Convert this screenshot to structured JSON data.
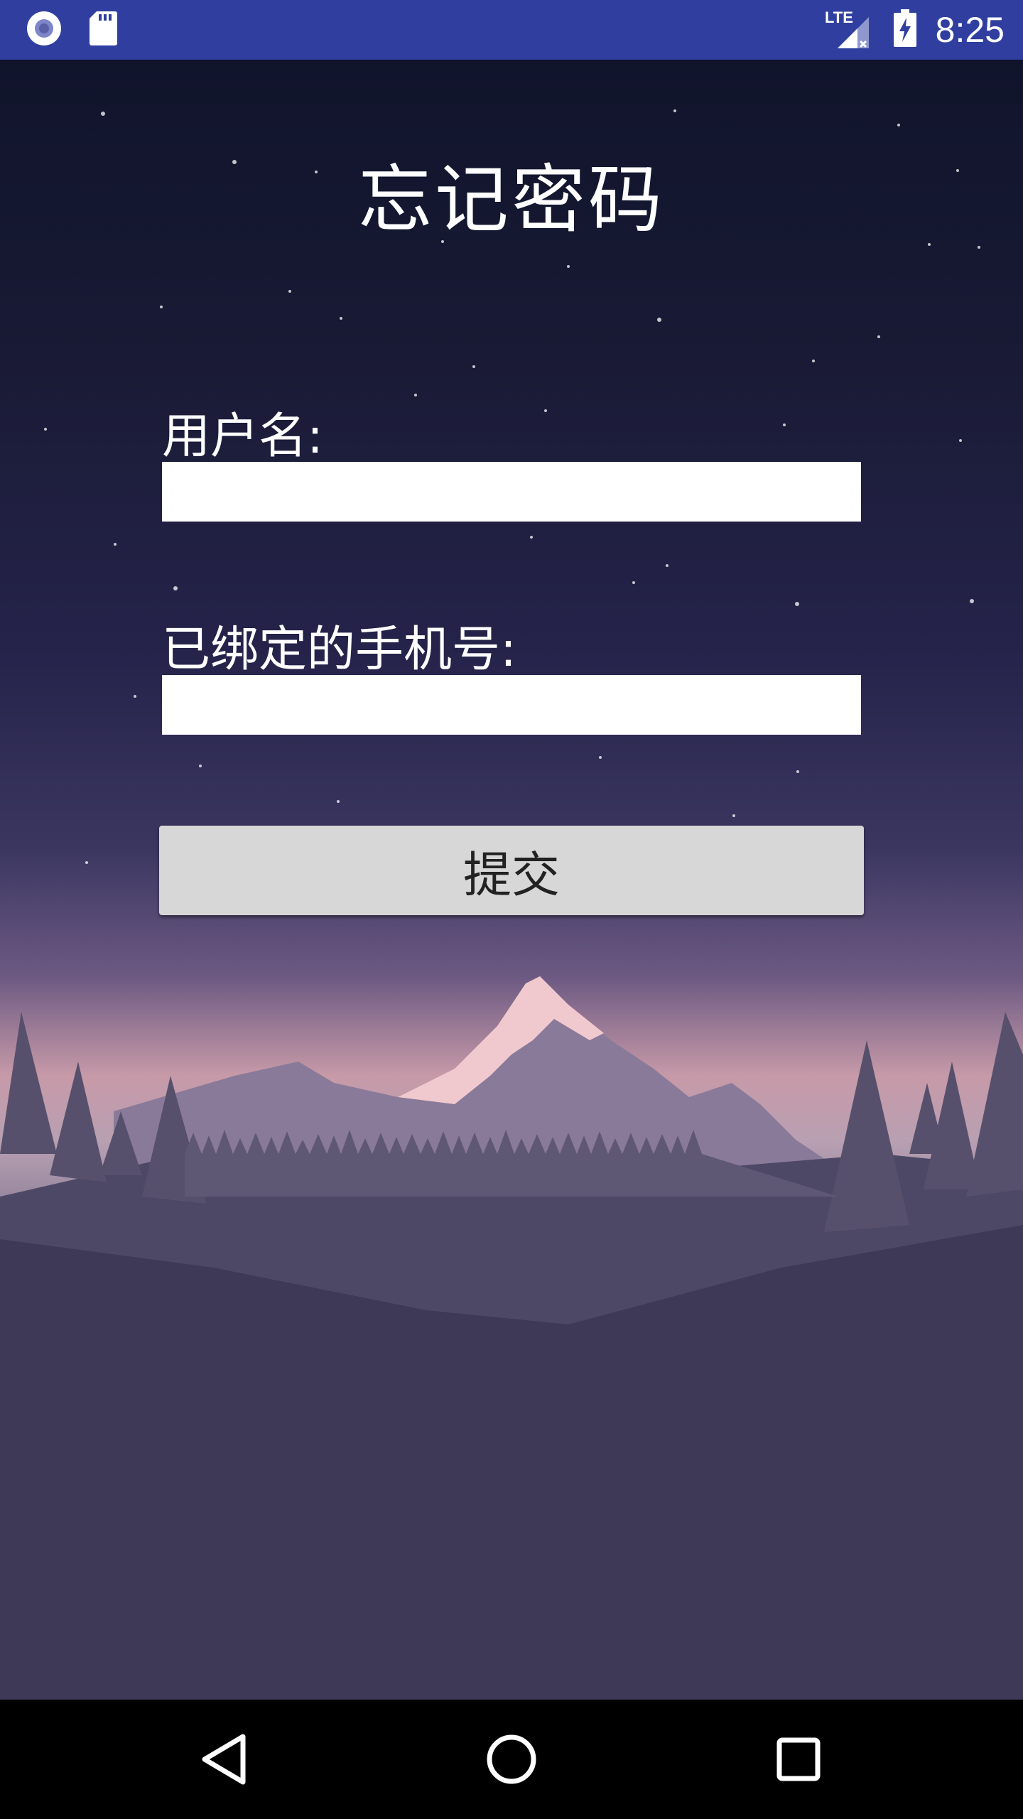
{
  "status_bar": {
    "time": "8:25",
    "network": "LTE",
    "icons": [
      "circle-notification-icon",
      "sd-card-icon",
      "lte-signal-icon",
      "battery-charging-icon"
    ]
  },
  "page": {
    "title": "忘记密码"
  },
  "form": {
    "username_label": "用户名:",
    "username_value": "",
    "phone_label": "已绑定的手机号:",
    "phone_value": "",
    "submit_label": "提交"
  },
  "navigation": {
    "icons": [
      "back-triangle-icon",
      "home-circle-icon",
      "recents-square-icon"
    ]
  },
  "colors": {
    "status_bar": "#303f9f",
    "button": "#d7d7d7",
    "input": "#ffffff",
    "text": "#ffffff"
  }
}
